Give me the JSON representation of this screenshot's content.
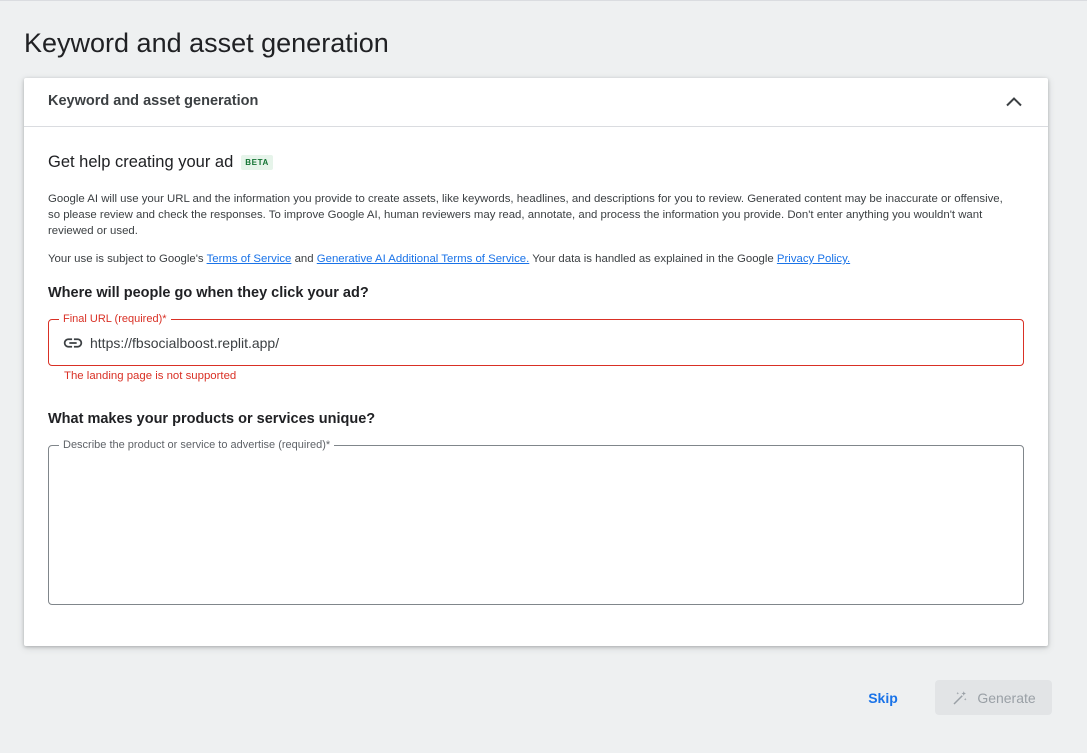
{
  "page": {
    "title": "Keyword and asset generation"
  },
  "card": {
    "header_title": "Keyword and asset generation",
    "collapse_icon": "chevron-up-icon",
    "help_title": "Get help creating your ad",
    "beta_badge": "BETA",
    "disclaimer": "Google AI will use your URL and the information you provide to create assets, like keywords, headlines, and descriptions for you to review. Generated content may be inaccurate or offensive, so please review and check the responses. To improve Google AI, human reviewers may read, annotate, and process the information you provide. Don't enter anything you wouldn't want reviewed or used.",
    "terms": {
      "prefix": "Your use is subject to Google's ",
      "tos_link": "Terms of Service",
      "and": " and ",
      "genai_link": "Generative AI Additional Terms of Service.",
      "middle": " Your data is handled as explained in the Google ",
      "privacy_link": "Privacy Policy."
    }
  },
  "url_section": {
    "question": "Where will people go when they click your ad?",
    "field_label": "Final URL (required)*",
    "icon": "link-icon",
    "value": "https://fbsocialboost.replit.app/",
    "error": "The landing page is not supported"
  },
  "description_section": {
    "question": "What makes your products or services unique?",
    "field_label": "Describe the product or service to advertise (required)*",
    "value": ""
  },
  "actions": {
    "skip_label": "Skip",
    "generate_label": "Generate",
    "generate_icon": "magic-wand-icon",
    "generate_enabled": false
  },
  "colors": {
    "accent": "#1a73e8",
    "error": "#d93025",
    "beta_bg": "#e6f4ea",
    "beta_text": "#137333",
    "background": "#eef0f1"
  }
}
